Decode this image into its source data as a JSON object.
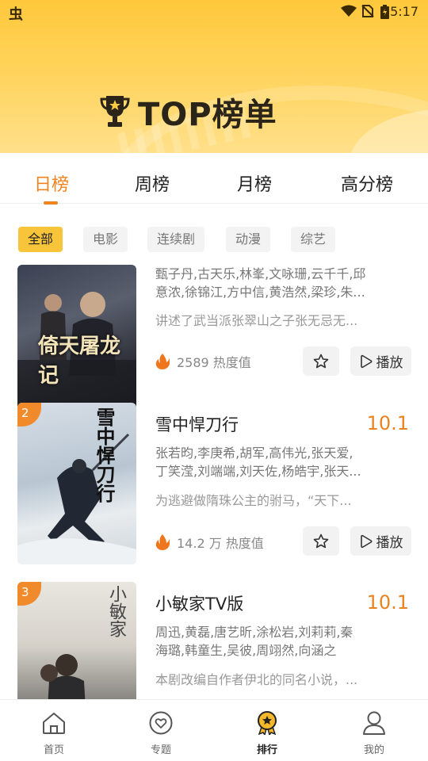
{
  "status_bar": {
    "time": "5:17",
    "app_icon": "虫"
  },
  "header": {
    "title": "TOP榜单"
  },
  "tabs": [
    {
      "label": "日榜",
      "active": true
    },
    {
      "label": "周榜",
      "active": false
    },
    {
      "label": "月榜",
      "active": false
    },
    {
      "label": "高分榜",
      "active": false
    }
  ],
  "filters": [
    {
      "label": "全部",
      "active": true
    },
    {
      "label": "电影",
      "active": false
    },
    {
      "label": "连续剧",
      "active": false
    },
    {
      "label": "动漫",
      "active": false
    },
    {
      "label": "综艺",
      "active": false
    }
  ],
  "items": [
    {
      "rank": "",
      "title": "",
      "score": "",
      "cast_line1": "甄子丹,古天乐,林峯,文咏珊,云千千,邱",
      "cast_line2": "意浓,徐锦江,方中信,黄浩然,梁珍,朱...",
      "description": "讲述了武当派张翠山之子张无忌无...",
      "heat": "2589 热度值",
      "poster_text": "倚天屠龙记"
    },
    {
      "rank": "2",
      "title": "雪中悍刀行",
      "score": "10.1",
      "cast_line1": "张若昀,李庚希,胡军,高伟光,张天爱,",
      "cast_line2": "丁笑滢,刘端端,刘天佐,杨皓宇,张天...",
      "description": "为逃避做隋珠公主的驸马，“天下...",
      "heat": "14.2 万 热度值",
      "poster_text": "雪中悍刀行"
    },
    {
      "rank": "3",
      "title": "小敏家TV版",
      "score": "10.1",
      "cast_line1": "周迅,黄磊,唐艺昕,涂松岩,刘莉莉,秦",
      "cast_line2": "海璐,韩童生,吴彼,周翊然,向涵之",
      "description": "本剧改编自作者伊北的同名小说，...",
      "heat": "",
      "poster_text": "小敏家"
    }
  ],
  "actions": {
    "play_label": "播放"
  },
  "bottom_nav": [
    {
      "label": "首页",
      "icon": "home-icon",
      "active": false
    },
    {
      "label": "专题",
      "icon": "heart-icon",
      "active": false
    },
    {
      "label": "排行",
      "icon": "medal-icon",
      "active": true
    },
    {
      "label": "我的",
      "icon": "user-icon",
      "active": false
    }
  ],
  "colors": {
    "accent": "#f0831f",
    "chip_active": "#f8c43a",
    "header": "#ffcb45"
  }
}
